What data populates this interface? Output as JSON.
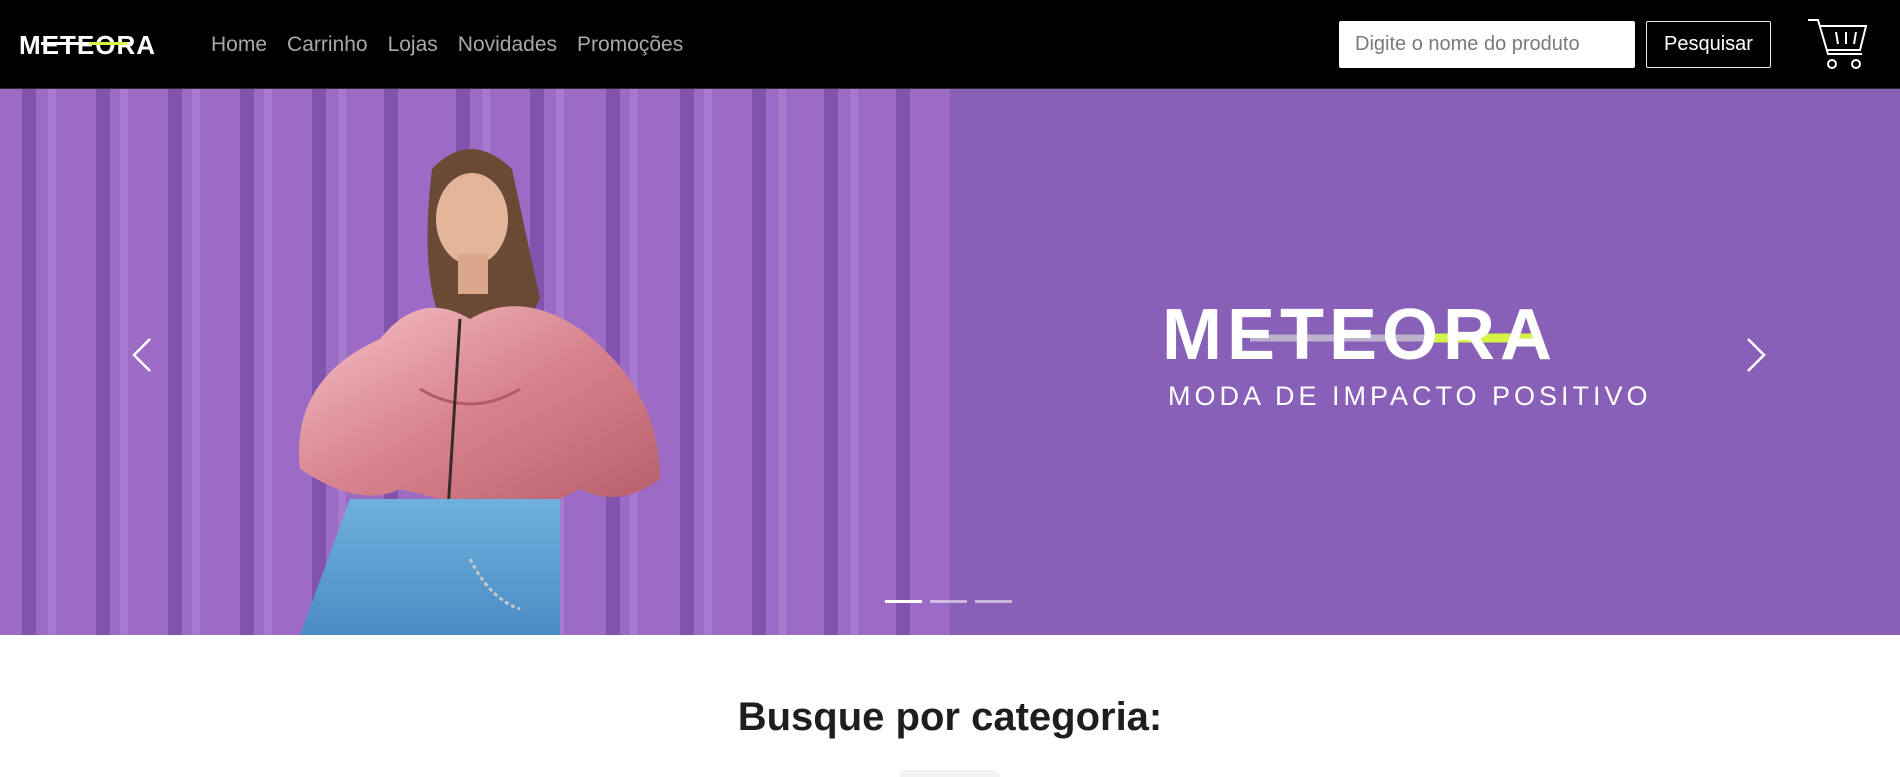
{
  "header": {
    "brand": "METEORA",
    "nav": [
      "Home",
      "Carrinho",
      "Lojas",
      "Novidades",
      "Promoções"
    ],
    "search": {
      "placeholder": "Digite o nome do produto",
      "value": "",
      "button_label": "Pesquisar"
    },
    "cart_icon": "shopping-cart-icon"
  },
  "hero": {
    "brand_text": "METEORA",
    "tagline": "MODA DE IMPACTO POSITIVO",
    "slide_count": 3,
    "active_slide": 1,
    "background_color": "#8860b7",
    "accent_color": "#d4f545"
  },
  "categories": {
    "title": "Busque por categoria:"
  }
}
